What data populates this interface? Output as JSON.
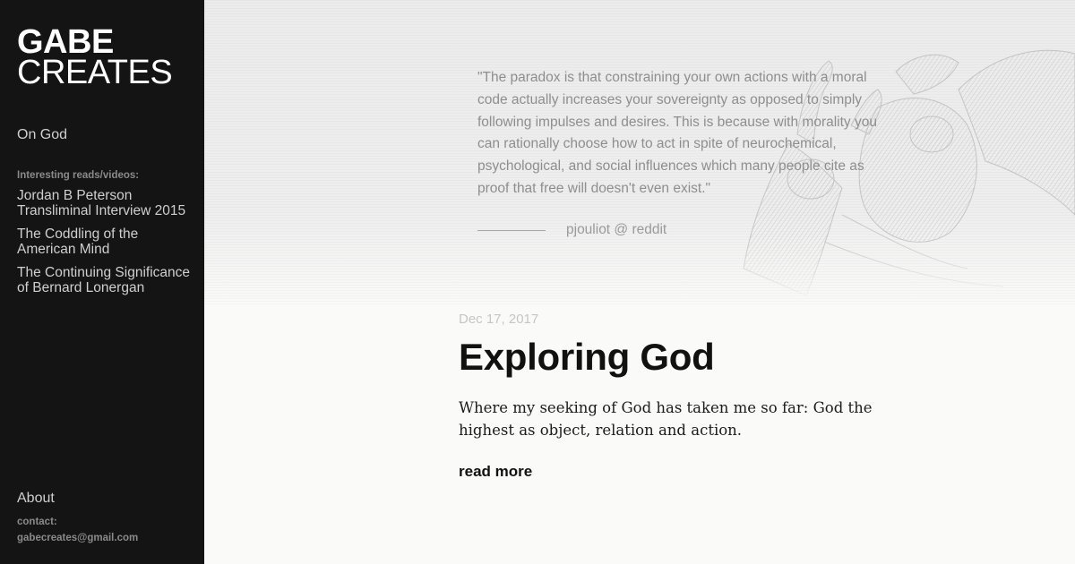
{
  "sidebar": {
    "logo_line1": "GABE",
    "logo_line2": "CREATES",
    "nav_top": "On God",
    "reads_label": "Interesting reads/videos:",
    "reads": [
      {
        "label": "Jordan B Peterson Transliminal Interview 2015"
      },
      {
        "label": "The Coddling of the American Mind"
      },
      {
        "label": "The Continuing Significance of Bernard Lonergan"
      }
    ],
    "about": "About",
    "contact_label": "contact:",
    "contact_email": "gabecreates@gmail.com"
  },
  "hero": {
    "quote": "\"The paradox is that constraining your own actions with a moral code actually increases your sovereignty as opposed to simply following impulses and desires. This is because with morality you can rationally choose how to act in spite of neurochemical, psychological, and social influences which many people cite as proof that free will doesn't even exist.\"",
    "source": "pjouliot @ reddit",
    "image_icon": "engraving-angel-wrestling-icon"
  },
  "post": {
    "date": "Dec 17, 2017",
    "title": "Exploring God",
    "excerpt": "Where my seeking of God has taken me so far: God the highest as object, relation and action.",
    "read_more": "read more"
  },
  "colors": {
    "sidebar_bg": "#141414",
    "page_bg": "#fafaf9",
    "title": "#111111",
    "quote_text": "#8e8e8e"
  }
}
